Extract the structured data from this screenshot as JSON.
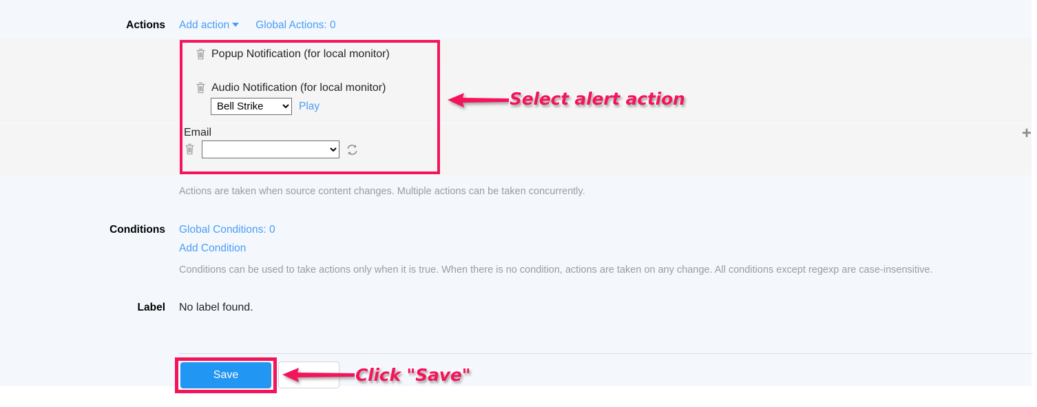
{
  "page": {
    "background_color": "#f4f8fd",
    "row_band_color": "#f5f5f5"
  },
  "actions": {
    "label": "Actions",
    "add_action_link": "Add action",
    "global_actions_link": "Global Actions: 0",
    "helper_text": "Actions are taken when source content changes. Multiple actions can be taken concurrently.",
    "items": [
      {
        "name": "popup-notification",
        "title": "Popup Notification (for local monitor)",
        "delete_icon": "trash-icon"
      },
      {
        "name": "audio-notification",
        "title": "Audio Notification (for local monitor)",
        "delete_icon": "trash-icon",
        "sound_selected": "Bell Strike",
        "sound_options": [
          "Bell Strike"
        ],
        "play_link": "Play"
      },
      {
        "name": "email",
        "title": "Email",
        "delete_icon": "trash-icon",
        "email_selected": "",
        "email_options": [
          ""
        ],
        "refresh_icon": "refresh-icon"
      }
    ]
  },
  "conditions": {
    "label": "Conditions",
    "global_conditions_link": "Global Conditions: 0",
    "add_condition_link": "Add Condition",
    "helper_text": "Conditions can be used to take actions only when it is true. When there is no condition, actions are taken on any change. All conditions except regexp are case-insensitive."
  },
  "label_section": {
    "label": "Label",
    "value": "No label found."
  },
  "footer": {
    "save_label": "Save",
    "secondary_label": ""
  },
  "misc": {
    "plus_icon": "+"
  },
  "annotations": {
    "accent_color": "#f4145b",
    "select_action": "Select alert action",
    "click_save": "Click \"Save\""
  }
}
